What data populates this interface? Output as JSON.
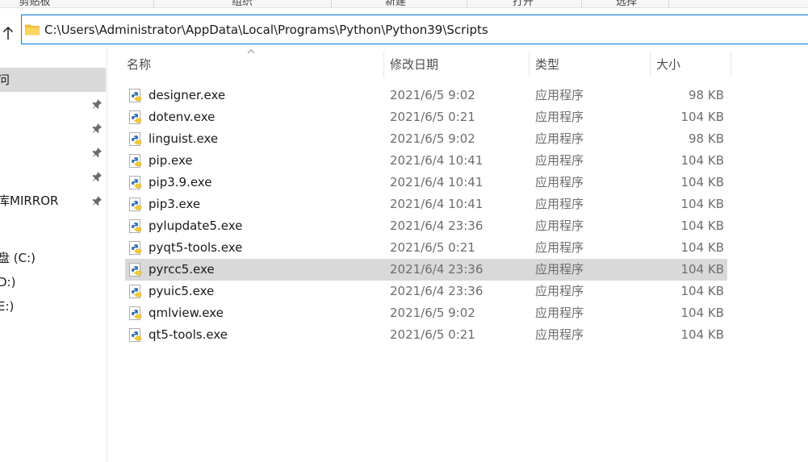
{
  "ribbon": {
    "groups": [
      "剪贴板",
      "组织",
      "新建",
      "打开",
      "选择"
    ]
  },
  "address": {
    "path": "C:\\Users\\Administrator\\AppData\\Local\\Programs\\Python\\Python39\\Scripts"
  },
  "nav": {
    "items": [
      {
        "label": "问"
      },
      {
        "label": ""
      },
      {
        "label": ""
      },
      {
        "label": ""
      },
      {
        "label": ""
      },
      {
        "label": "库MIRROR"
      },
      {
        "label": ""
      },
      {
        "label": "盘 (C:)"
      },
      {
        "label": "D:)"
      },
      {
        "label": "E:)"
      }
    ]
  },
  "columns": {
    "name": "名称",
    "date": "修改日期",
    "type": "类型",
    "size": "大小"
  },
  "files": [
    {
      "name": "designer.exe",
      "date": "2021/6/5 9:02",
      "type": "应用程序",
      "size": "98 KB"
    },
    {
      "name": "dotenv.exe",
      "date": "2021/6/5 0:21",
      "type": "应用程序",
      "size": "104 KB"
    },
    {
      "name": "linguist.exe",
      "date": "2021/6/5 9:02",
      "type": "应用程序",
      "size": "98 KB"
    },
    {
      "name": "pip.exe",
      "date": "2021/6/4 10:41",
      "type": "应用程序",
      "size": "104 KB"
    },
    {
      "name": "pip3.9.exe",
      "date": "2021/6/4 10:41",
      "type": "应用程序",
      "size": "104 KB"
    },
    {
      "name": "pip3.exe",
      "date": "2021/6/4 10:41",
      "type": "应用程序",
      "size": "104 KB"
    },
    {
      "name": "pylupdate5.exe",
      "date": "2021/6/4 23:36",
      "type": "应用程序",
      "size": "104 KB"
    },
    {
      "name": "pyqt5-tools.exe",
      "date": "2021/6/5 0:21",
      "type": "应用程序",
      "size": "104 KB"
    },
    {
      "name": "pyrcc5.exe",
      "date": "2021/6/4 23:36",
      "type": "应用程序",
      "size": "104 KB"
    },
    {
      "name": "pyuic5.exe",
      "date": "2021/6/4 23:36",
      "type": "应用程序",
      "size": "104 KB"
    },
    {
      "name": "qmlview.exe",
      "date": "2021/6/5 9:02",
      "type": "应用程序",
      "size": "104 KB"
    },
    {
      "name": "qt5-tools.exe",
      "date": "2021/6/5 0:21",
      "type": "应用程序",
      "size": "104 KB"
    }
  ],
  "selected_file": "pyrcc5.exe",
  "colors": {
    "selection": "#d9d9d9",
    "address_border": "#0078d7",
    "folder": "#f5c342",
    "python_blue": "#3a72b0",
    "python_yellow": "#f3ce3a"
  }
}
